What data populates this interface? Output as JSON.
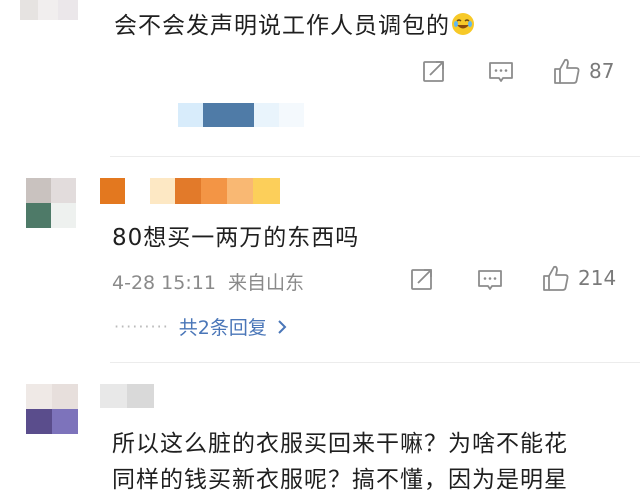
{
  "colors": {
    "link": "#4a76b8",
    "meta": "#8a8a8a",
    "icon": "#8c8c8c"
  },
  "comments": [
    {
      "text": "会不会发声明说工作人员调包的",
      "emoji": "laughing-crying-emoji",
      "likes": "87"
    },
    {
      "text": "80想买一两万的东西吗",
      "date": "4-28 15:11",
      "location": "来自山东",
      "likes": "214",
      "reply_dots": "·········",
      "replies_link": "共2条回复"
    },
    {
      "text_line1": "所以这么脏的衣服买回来干嘛？为啥不能花",
      "text_line2": "同样的钱买新衣服呢？搞不懂，因为是明星"
    }
  ]
}
